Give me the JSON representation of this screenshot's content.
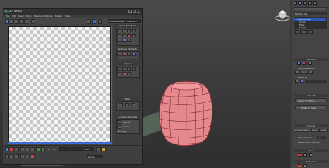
{
  "uv_editor": {
    "title": "Edit UVWs",
    "menus": [
      "File",
      "Edit",
      "Select",
      "Tools",
      "Mapping",
      "Options",
      "Display",
      "View"
    ],
    "map_select": "CheckerPattern ( Checker )",
    "panels": {
      "quick_transform": "Quick Transform",
      "reshape_elements": "Reshape Elements",
      "explode": "Explode",
      "stitch": "Stitch",
      "arrange_elements": "Arrange Elements",
      "rescale": "Rescale",
      "rotate": "Rotate",
      "padding": "Padding:"
    },
    "bottom": {
      "xy_label": "XY",
      "uv_label": "UV",
      "channel": "0.0",
      "filter_all": "All IDs"
    }
  },
  "command_panel": {
    "modifier_list": "Modifier List",
    "stack": [
      "Unwrap UVW",
      "Vertex",
      "Edge",
      "Polygon"
    ],
    "selection_header": "Selection",
    "modify_selection": "Modify Selection",
    "select_by": "Select By",
    "edit_uvs": "Edit UVs",
    "open_uv_editor": "Open UV Editor ...",
    "tweak_in_view": "Tweak In View",
    "channel_header": "Channel",
    "reset_uvws": "Reset UVWs",
    "save": "Save...",
    "load": "Load...",
    "map_channel": "Map Channel:",
    "map_channel_value": "1",
    "vertex_color_channel": "Vertex Color Channel",
    "peel_header": "Peel",
    "projection_header": "Projection"
  },
  "colors": {
    "mesh_fill": "#e6898c",
    "mesh_edge": "#7a2c34",
    "uv_axis": "#3c6bd6",
    "stack_highlight": "#2c58b8"
  }
}
